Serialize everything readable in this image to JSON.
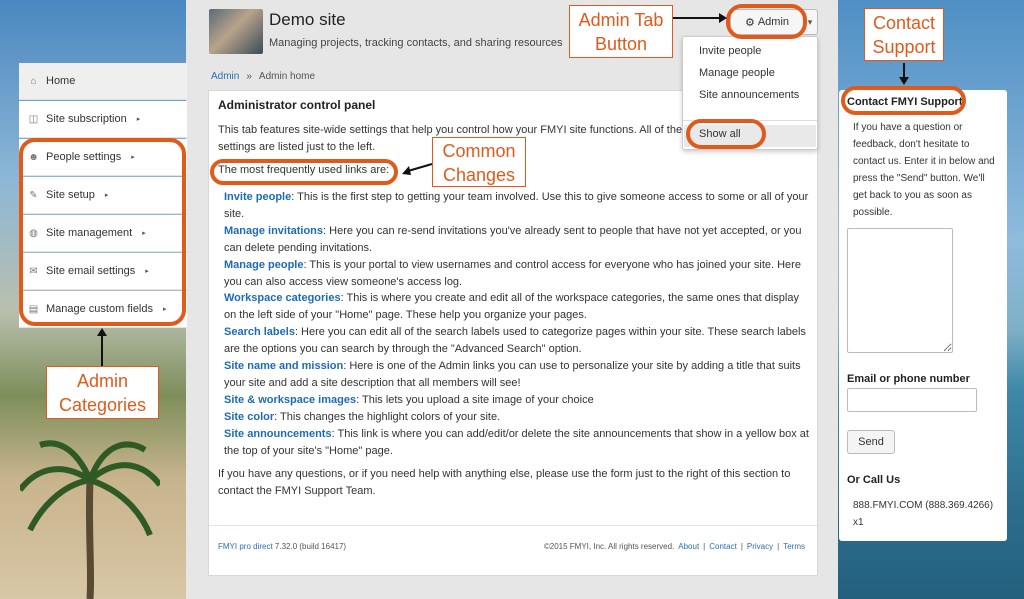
{
  "header": {
    "site_title": "Demo site",
    "tagline": "Managing projects, tracking contacts, and sharing resources",
    "admin_button": "Admin",
    "admin_menu": [
      "Invite people",
      "Manage people",
      "Site announcements",
      "Show all"
    ]
  },
  "breadcrumb": {
    "root": "Admin",
    "sep": "»",
    "current": "Admin home"
  },
  "sidebar": {
    "items": [
      {
        "label": "Home",
        "icon": "home-icon"
      },
      {
        "label": "Site subscription",
        "icon": "tag-icon"
      },
      {
        "label": "People settings",
        "icon": "people-icon"
      },
      {
        "label": "Site setup",
        "icon": "wrench-icon"
      },
      {
        "label": "Site management",
        "icon": "globe-icon"
      },
      {
        "label": "Site email settings",
        "icon": "envelope-icon"
      },
      {
        "label": "Manage custom fields",
        "icon": "list-icon"
      }
    ]
  },
  "panel": {
    "title": "Administrator control panel",
    "intro": "This tab features site-wide settings that help you control how your FMYI site functions. All of the settings are listed just to the left.",
    "lead": "The most frequently used links are:",
    "links": [
      {
        "term": "Invite people",
        "desc": ": This is the first step to getting your team involved. Use this to give someone access to some or all of your site."
      },
      {
        "term": "Manage invitations",
        "desc": ": Here you can re-send invitations you've already sent to people that have not yet accepted, or you can delete pending invitations."
      },
      {
        "term": "Manage people",
        "desc": ": This is your portal to view usernames and control access for everyone who has joined your site. Here you can also access view someone's access log."
      },
      {
        "term": "Workspace categories",
        "desc": ": This is where you create and edit all of the workspace categories, the same ones that display on the left side of your \"Home\" page. These help you organize your pages."
      },
      {
        "term": "Search labels",
        "desc": ": Here you can edit all of the search labels used to categorize pages within your site. These search labels are the options you can search by through the \"Advanced Search\" option."
      },
      {
        "term": "Site name and mission",
        "desc": ": Here is one of the Admin links you can use to personalize your site by adding a title that suits your site and add a site description that all members will see!"
      },
      {
        "term": "Site & workspace images",
        "desc": ": This lets you upload a site image of your choice"
      },
      {
        "term": "Site color",
        "desc": ": This changes the highlight colors of your site."
      },
      {
        "term": "Site announcements",
        "desc": ": This link is where you can add/edit/or delete the site announcements that show in a yellow box at the top of your site's \"Home\" page."
      }
    ],
    "outro": "If you have any questions, or if you need help with anything else, please use the form just to the right of this section to contact the FMYI Support Team."
  },
  "footer": {
    "product": "FMYI pro direct",
    "version": " 7.32.0 (build 16417)",
    "copyright": "©2015 FMYI, Inc. All rights reserved.",
    "links": [
      "About",
      "Contact",
      "Privacy",
      "Terms"
    ],
    "divider": "|"
  },
  "contact": {
    "title": "Contact FMYI Support",
    "desc": "If you have a question or feedback, don't hesitate to contact us. Enter it in below and press the \"Send\" button. We'll get back to you as soon as possible.",
    "email_label": "Email or phone number",
    "send_button": "Send",
    "call_title": "Or Call Us",
    "phone": "888.FMYI.COM (888.369.4266) x1"
  },
  "annotations": {
    "admin_tab": "Admin Tab Button",
    "contact_support": "Contact Support",
    "common_changes": "Common Changes",
    "admin_categories": "Admin Categories"
  },
  "colors": {
    "accent": "#e05a1b",
    "link": "#1d6bb8"
  }
}
